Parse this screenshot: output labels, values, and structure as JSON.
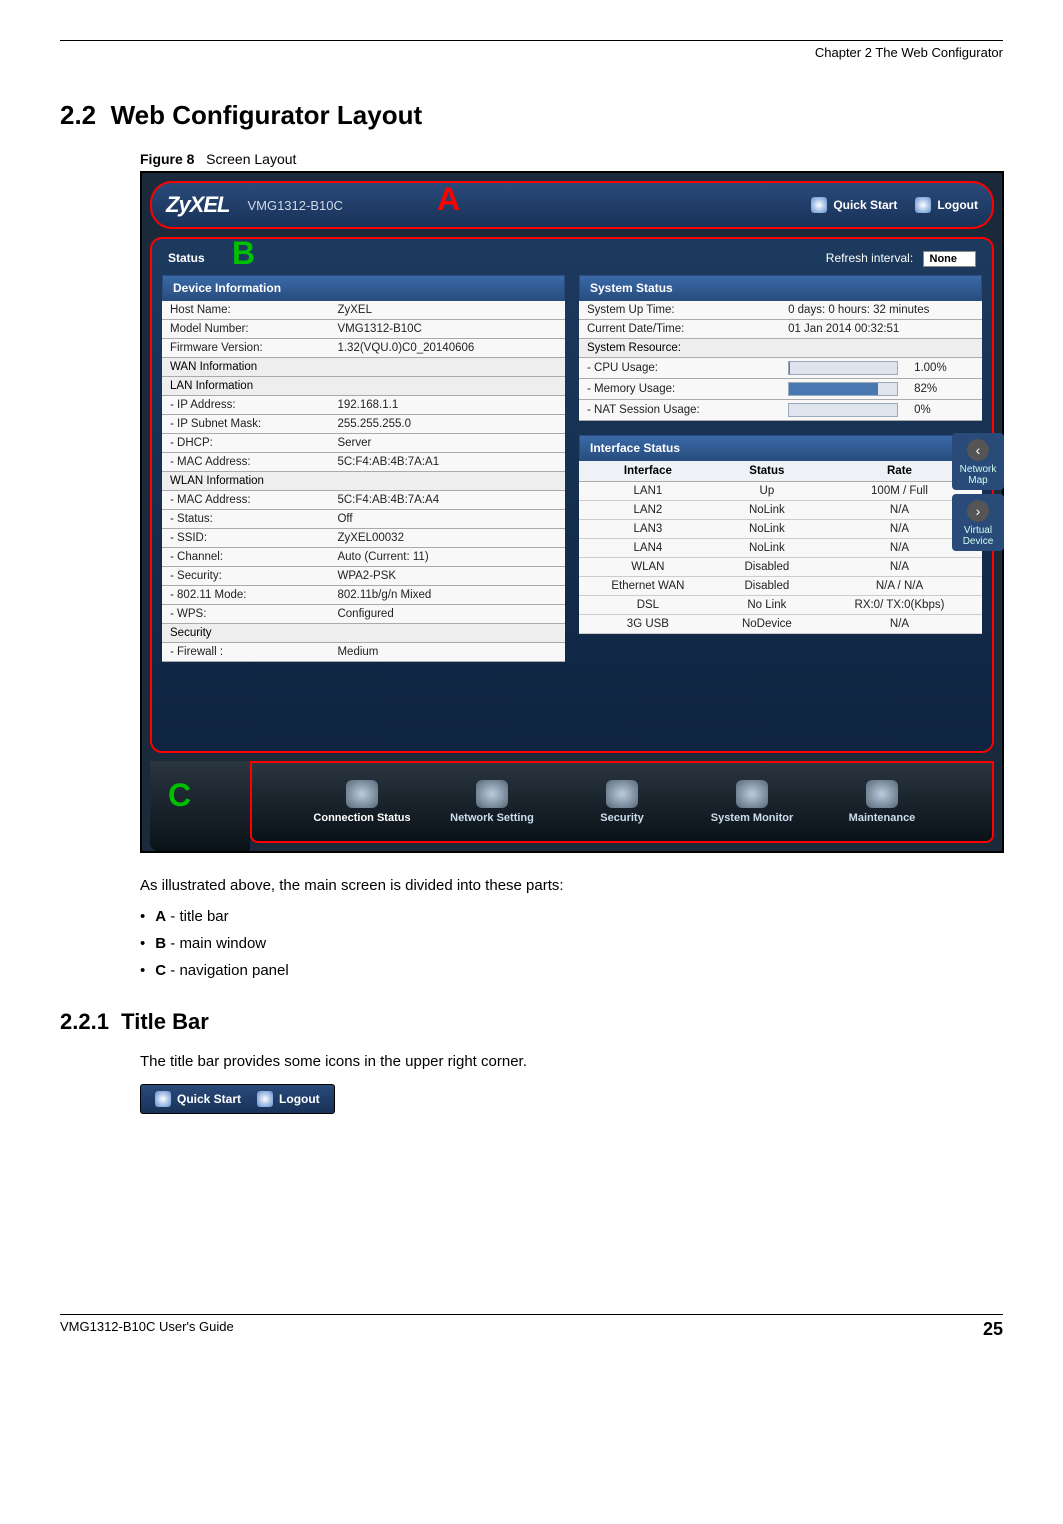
{
  "chapter_header": "Chapter 2 The Web Configurator",
  "section_number": "2.2",
  "section_title": "Web Configurator Layout",
  "figure_label": "Figure 8",
  "figure_title": "Screen Layout",
  "titlebar": {
    "logo": "ZyXEL",
    "model": "VMG1312-B10C",
    "quick_start": "Quick Start",
    "logout": "Logout"
  },
  "annotations": {
    "A": "A",
    "B": "B",
    "C": "C"
  },
  "status": {
    "label": "Status",
    "refresh_label": "Refresh interval:",
    "refresh_value": "None"
  },
  "device_info": {
    "header": "Device Information",
    "rows": [
      {
        "k": "Host Name:",
        "v": "ZyXEL"
      },
      {
        "k": "Model Number:",
        "v": "VMG1312-B10C"
      },
      {
        "k": "Firmware Version:",
        "v": "1.32(VQU.0)C0_20140606"
      },
      {
        "k": "WAN Information",
        "v": "",
        "group": true
      },
      {
        "k": "LAN Information",
        "v": "",
        "group": true
      },
      {
        "k": "  - IP Address:",
        "v": "192.168.1.1"
      },
      {
        "k": "  - IP Subnet Mask:",
        "v": "255.255.255.0"
      },
      {
        "k": "  - DHCP:",
        "v": "Server"
      },
      {
        "k": "  - MAC Address:",
        "v": "5C:F4:AB:4B:7A:A1"
      },
      {
        "k": "WLAN Information",
        "v": "",
        "group": true
      },
      {
        "k": "  - MAC Address:",
        "v": "5C:F4:AB:4B:7A:A4"
      },
      {
        "k": "  - Status:",
        "v": "Off"
      },
      {
        "k": "  - SSID:",
        "v": "ZyXEL00032"
      },
      {
        "k": "  - Channel:",
        "v": "Auto (Current: 11)"
      },
      {
        "k": "  - Security:",
        "v": "WPA2-PSK"
      },
      {
        "k": "  - 802.11 Mode:",
        "v": "802.11b/g/n Mixed"
      },
      {
        "k": "  - WPS:",
        "v": "Configured"
      },
      {
        "k": "Security",
        "v": "",
        "group": true
      },
      {
        "k": "  - Firewall :",
        "v": "Medium"
      }
    ]
  },
  "system_status": {
    "header": "System Status",
    "uptime_k": "System Up Time:",
    "uptime_v": "0 days: 0 hours: 32 minutes",
    "datetime_k": "Current Date/Time:",
    "datetime_v": "01 Jan 2014 00:32:51",
    "resource_k": "System Resource:",
    "cpu_k": "  - CPU Usage:",
    "cpu_v": "1.00%",
    "mem_k": "  - Memory Usage:",
    "mem_v": "82%",
    "nat_k": "  - NAT Session Usage:",
    "nat_v": "0%"
  },
  "interface_status": {
    "header": "Interface Status",
    "cols": [
      "Interface",
      "Status",
      "Rate"
    ],
    "rows": [
      [
        "LAN1",
        "Up",
        "100M / Full"
      ],
      [
        "LAN2",
        "NoLink",
        "N/A"
      ],
      [
        "LAN3",
        "NoLink",
        "N/A"
      ],
      [
        "LAN4",
        "NoLink",
        "N/A"
      ],
      [
        "WLAN",
        "Disabled",
        "N/A"
      ],
      [
        "Ethernet WAN",
        "Disabled",
        "N/A / N/A"
      ],
      [
        "DSL",
        "No Link",
        "RX:0/ TX:0(Kbps)"
      ],
      [
        "3G USB",
        "NoDevice",
        "N/A"
      ]
    ]
  },
  "side": {
    "network_map": "Network Map",
    "virtual_device": "Virtual Device"
  },
  "nav": {
    "items": [
      "Connection Status",
      "Network Setting",
      "Security",
      "System Monitor",
      "Maintenance"
    ]
  },
  "body_intro": "As illustrated above, the main screen is divided into these parts:",
  "parts": {
    "a_label": "A",
    "a_desc": " - title bar",
    "b_label": "B",
    "b_desc": " - main window",
    "c_label": "C",
    "c_desc": " - navigation panel"
  },
  "subsection_number": "2.2.1",
  "subsection_title": "Title Bar",
  "subsection_body": "The title bar provides some icons in the upper right corner.",
  "inset": {
    "quick_start": "Quick Start",
    "logout": "Logout"
  },
  "footer": {
    "guide": "VMG1312-B10C User's Guide",
    "page": "25"
  }
}
